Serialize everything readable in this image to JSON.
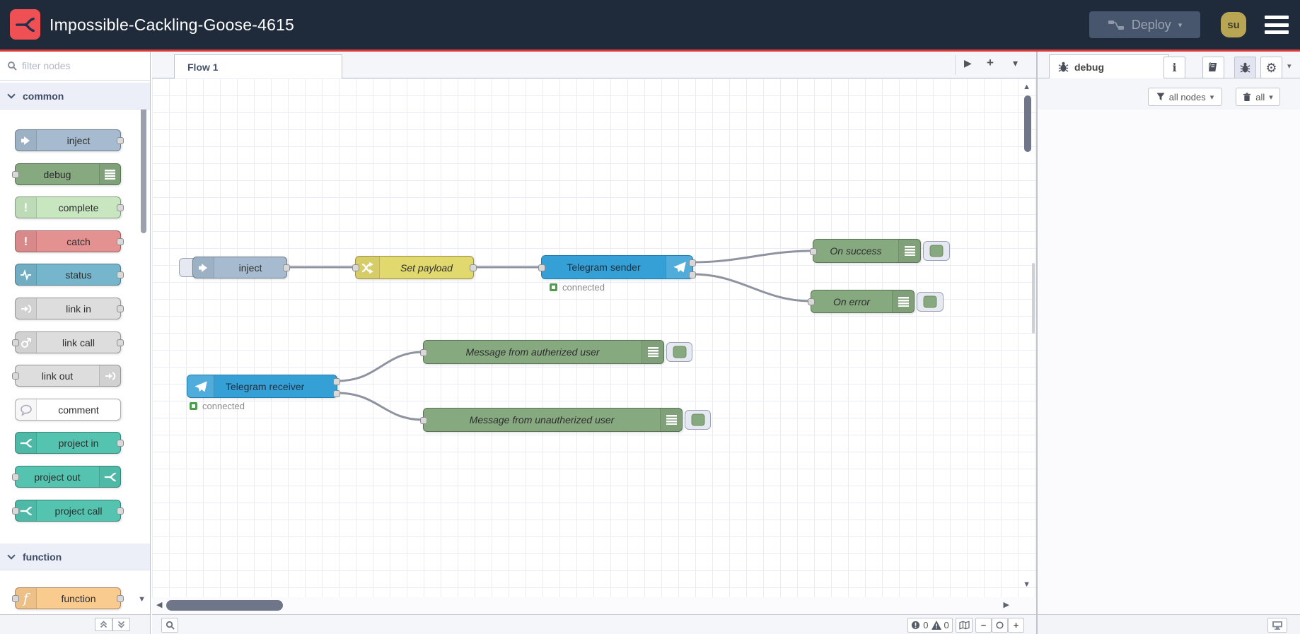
{
  "header": {
    "title": "Impossible-Cackling-Goose-4615",
    "deploy_label": "Deploy",
    "avatar_label": "su"
  },
  "palette": {
    "search_placeholder": "filter nodes",
    "sections": {
      "common": {
        "label": "common"
      },
      "function": {
        "label": "function"
      }
    },
    "items": {
      "inject": "inject",
      "debug": "debug",
      "complete": "complete",
      "catch": "catch",
      "status": "status",
      "link_in": "link in",
      "link_call": "link call",
      "link_out": "link out",
      "comment": "comment",
      "project_in": "project in",
      "project_out": "project out",
      "project_call": "project call",
      "function": "function"
    }
  },
  "workspace": {
    "tab_label": "Flow 1",
    "nodes": {
      "inject": {
        "label": "inject"
      },
      "set_payload": {
        "label": "Set payload"
      },
      "telegram_sender": {
        "label": "Telegram sender",
        "status": "connected"
      },
      "on_success": {
        "label": "On success"
      },
      "on_error": {
        "label": "On error"
      },
      "telegram_receiver": {
        "label": "Telegram receiver",
        "status": "connected"
      },
      "msg_authorized": {
        "label": "Message from autherized user"
      },
      "msg_unauthorized": {
        "label": "Message from unautherized user"
      }
    },
    "footer": {
      "errors": "0",
      "warnings": "0"
    }
  },
  "sidebar": {
    "tab_label": "debug",
    "filter_label": "all nodes",
    "clear_label": "all"
  },
  "colors": {
    "accent_red": "#dd3b3b",
    "header_bg": "#1f2a3a",
    "logo_red": "#ef5054",
    "node_inject": "#a6bbcf",
    "node_debug": "#87a980",
    "node_complete": "#c8e7c0",
    "node_catch": "#e49191",
    "node_status": "#76b6cd",
    "node_link": "#dddddd",
    "node_comment": "#ffffff",
    "node_project": "#54c3b0",
    "node_function": "#f9cb8f",
    "node_change": "#e2d96e",
    "node_telegram": "#34a0d6",
    "status_connected_green": "#4c9e4c",
    "wire_gray": "#8f93a0"
  },
  "icons": {
    "logo": "flowfuse-logo",
    "search": "magnifier",
    "deploy": "deploy-nodes",
    "menu": "hamburger",
    "sidebar_tabs": [
      "info",
      "book",
      "bug",
      "gear"
    ],
    "filter": "funnel",
    "clear": "trash",
    "map": "navigator-map",
    "zoom_controls": [
      "zoom-out",
      "zoom-reset",
      "zoom-in"
    ],
    "screen": "monitor"
  }
}
